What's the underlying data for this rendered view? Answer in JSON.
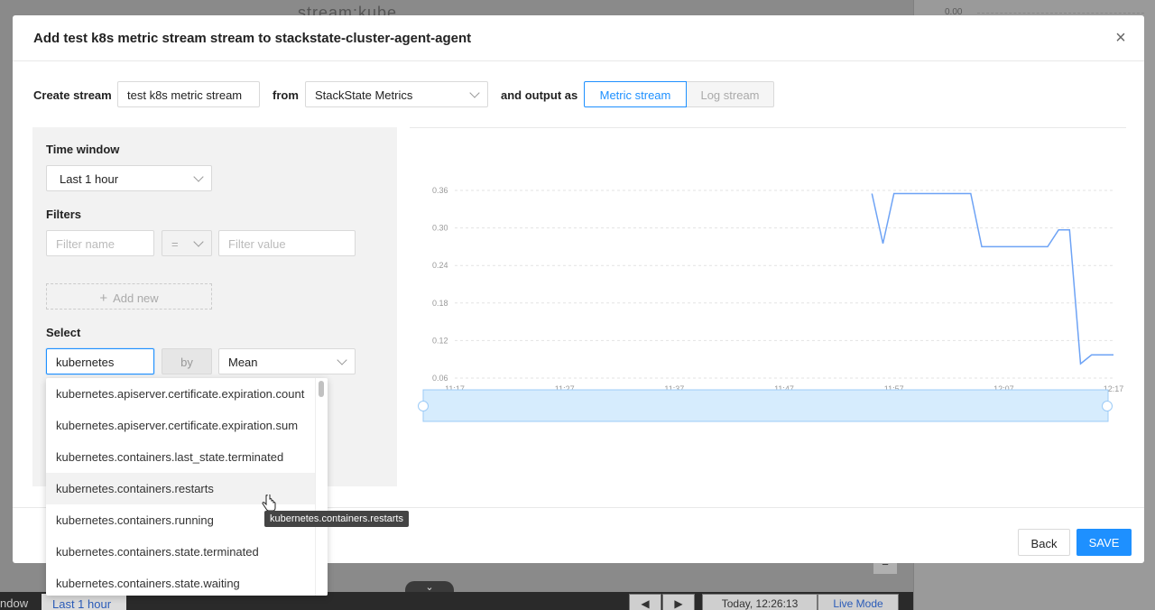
{
  "background": {
    "top_text": "stream:kube...",
    "right_tick": "0.00",
    "bottom_left_text": "ndow",
    "bottom_link": "Last 1 hour",
    "bottom_prev": "◀",
    "bottom_next": "▶",
    "bottom_time": "Today, 12:26:13",
    "bottom_live": "Live Mode",
    "minus": "−"
  },
  "modal": {
    "title": "Add test k8s metric stream stream to stackstate-cluster-agent-agent",
    "close_icon": "×",
    "create_stream_label": "Create stream",
    "stream_name": "test k8s metric stream",
    "from_label": "from",
    "source": "StackState Metrics",
    "output_label": "and output as",
    "output_options": [
      "Metric stream",
      "Log stream"
    ],
    "time_window_label": "Time window",
    "time_window_value": "Last 1 hour",
    "filters_label": "Filters",
    "filter_name_placeholder": "Filter name",
    "filter_operator": "=",
    "filter_value_placeholder": "Filter value",
    "add_new_label": "Add new",
    "add_icon": "+",
    "select_label": "Select",
    "select_value": "kubernetes",
    "by_label": "by",
    "aggregation": "Mean",
    "back_label": "Back",
    "save_label": "SAVE"
  },
  "dropdown": {
    "items": [
      "kubernetes.apiserver.certificate.expiration.count",
      "kubernetes.apiserver.certificate.expiration.sum",
      "kubernetes.containers.last_state.terminated",
      "kubernetes.containers.restarts",
      "kubernetes.containers.running",
      "kubernetes.containers.state.terminated",
      "kubernetes.containers.state.waiting"
    ],
    "hovered_index": 3,
    "tooltip": "kubernetes.containers.restarts"
  },
  "chart_data": {
    "type": "line",
    "y_ticks": [
      "0.36",
      "0.30",
      "0.24",
      "0.18",
      "0.12",
      "0.06"
    ],
    "x_ticks": [
      "11:17",
      "11:27",
      "11:37",
      "11:47",
      "11:57",
      "12:07",
      "12:17"
    ],
    "ylim": [
      0.06,
      0.36
    ],
    "grid": true,
    "color": "#6ea3f5",
    "series": [
      {
        "x": [
          "11:55",
          "11:56",
          "11:57",
          "12:04",
          "12:05",
          "12:11",
          "12:12",
          "12:13",
          "12:14",
          "12:15",
          "12:17"
        ],
        "values": [
          0.355,
          0.275,
          0.355,
          0.355,
          0.27,
          0.27,
          0.297,
          0.297,
          0.083,
          0.097,
          0.097
        ]
      }
    ]
  }
}
